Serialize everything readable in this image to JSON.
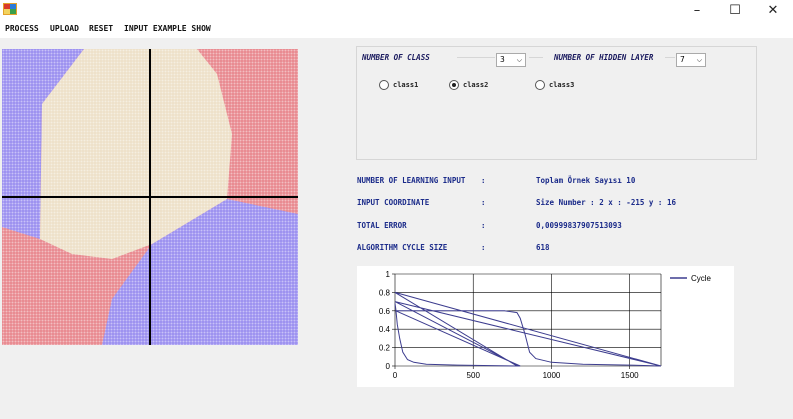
{
  "window": {
    "minimize": "–",
    "maximize": "☐",
    "close": "✕"
  },
  "menu": {
    "process": "PROCESS",
    "upload": "UPLOAD",
    "reset": "RESET",
    "input_example_show": "INPUT EXAMPLE SHOW"
  },
  "colors": {
    "class1": "#e8888e",
    "class2": "#ede0c8",
    "class3": "#9a8ff0",
    "axis": "#000000",
    "chart_line": "#3d3d8f"
  },
  "settings": {
    "number_of_class_label": "NUMBER OF CLASS",
    "number_of_class_value": "3",
    "number_of_hidden_layer_label": "NUMBER OF HIDDEN LAYER",
    "number_of_hidden_layer_value": "7",
    "classes": [
      {
        "label": "class1",
        "selected": false
      },
      {
        "label": "class2",
        "selected": true
      },
      {
        "label": "class3",
        "selected": false
      }
    ]
  },
  "info": [
    {
      "label": "NUMBER OF LEARNING INPUT",
      "sep": ":",
      "value": "Toplam Örnek Sayısı 10"
    },
    {
      "label": "INPUT COORDINATE",
      "sep": ":",
      "value": "Size Number : 2 x : -215 y : 16"
    },
    {
      "label": "TOTAL ERROR",
      "sep": ":",
      "value": "0,00999837907513093"
    },
    {
      "label": "ALGORITHM CYCLE SIZE",
      "sep": ":",
      "value": "618"
    }
  ],
  "chart_data": {
    "type": "line",
    "xlim": [
      0,
      1700
    ],
    "ylim": [
      0,
      1
    ],
    "xticks": [
      0,
      500,
      1000,
      1500
    ],
    "yticks": [
      0,
      0.2,
      0.4,
      0.6,
      0.8,
      1
    ],
    "ytick_labels": [
      "0",
      "0.2",
      "0.4",
      "0.6",
      "0.8",
      "1"
    ],
    "grid": true,
    "legend": "top-right",
    "series": [
      {
        "name": "Cycle",
        "x": [
          0,
          5,
          15,
          30,
          50,
          80,
          120,
          200,
          400,
          790,
          800,
          5,
          20,
          60,
          100,
          200,
          400,
          600,
          700,
          780,
          800,
          830,
          860,
          900,
          1000,
          1200,
          1500,
          1700,
          1700,
          0,
          0,
          780,
          790,
          0,
          0,
          1700
        ],
        "y": [
          0.68,
          0.62,
          0.45,
          0.3,
          0.15,
          0.07,
          0.04,
          0.02,
          0.01,
          0.0,
          0.0,
          0.6,
          0.6,
          0.6,
          0.6,
          0.6,
          0.6,
          0.6,
          0.6,
          0.58,
          0.52,
          0.35,
          0.15,
          0.08,
          0.04,
          0.02,
          0.01,
          0.0,
          0.0,
          0.8,
          0.8,
          0.0,
          0.0,
          0.7,
          0.7,
          0.0
        ]
      }
    ]
  }
}
